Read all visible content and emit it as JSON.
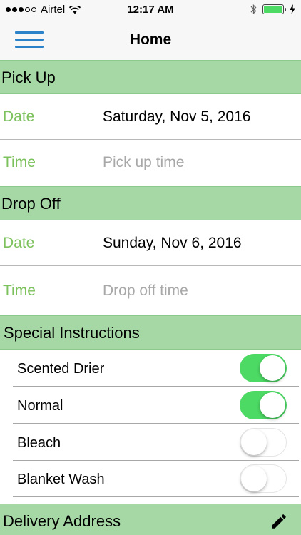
{
  "status_bar": {
    "carrier": "Airtel",
    "time": "12:17 AM",
    "battery_color": "#4cd964"
  },
  "nav": {
    "title": "Home",
    "menu_icon": "hamburger-menu-icon",
    "accent": "#2c82c9"
  },
  "pick_up": {
    "header": "Pick Up",
    "date_label": "Date",
    "date_value": "Saturday, Nov 5, 2016",
    "time_label": "Time",
    "time_placeholder": "Pick up time"
  },
  "drop_off": {
    "header": "Drop Off",
    "date_label": "Date",
    "date_value": "Sunday, Nov 6, 2016",
    "time_label": "Time",
    "time_placeholder": "Drop off time"
  },
  "special_instructions": {
    "header": "Special Instructions",
    "items": [
      {
        "label": "Scented Drier",
        "on": true
      },
      {
        "label": "Normal",
        "on": true
      },
      {
        "label": "Bleach",
        "on": false
      },
      {
        "label": "Blanket Wash",
        "on": false
      }
    ]
  },
  "delivery_address": {
    "header": "Delivery Address",
    "edit_icon": "pencil-icon"
  },
  "colors": {
    "section_header_bg": "#a6d8a6",
    "label_green": "#7cc15c",
    "toggle_on": "#4cd964",
    "placeholder_gray": "#a8a8a8"
  }
}
